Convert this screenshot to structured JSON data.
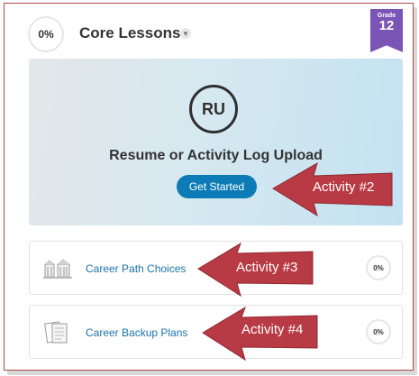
{
  "header": {
    "progress_text": "0%",
    "title": "Core Lessons",
    "badge": {
      "label": "Grade",
      "number": "12",
      "color": "#7b55b5"
    }
  },
  "featured": {
    "initials": "RU",
    "title": "Resume or Activity Log Upload",
    "button_label": "Get Started"
  },
  "activities": [
    {
      "label": "Career Path Choices",
      "progress_text": "0%"
    },
    {
      "label": "Career Backup Plans",
      "progress_text": "0%"
    }
  ],
  "annotations": [
    {
      "text": "Activity #2"
    },
    {
      "text": "Activity #3"
    },
    {
      "text": "Activity #4"
    }
  ],
  "colors": {
    "accent": "#0d7bb6",
    "arrow": "#b83a44",
    "link": "#1a73a8"
  }
}
